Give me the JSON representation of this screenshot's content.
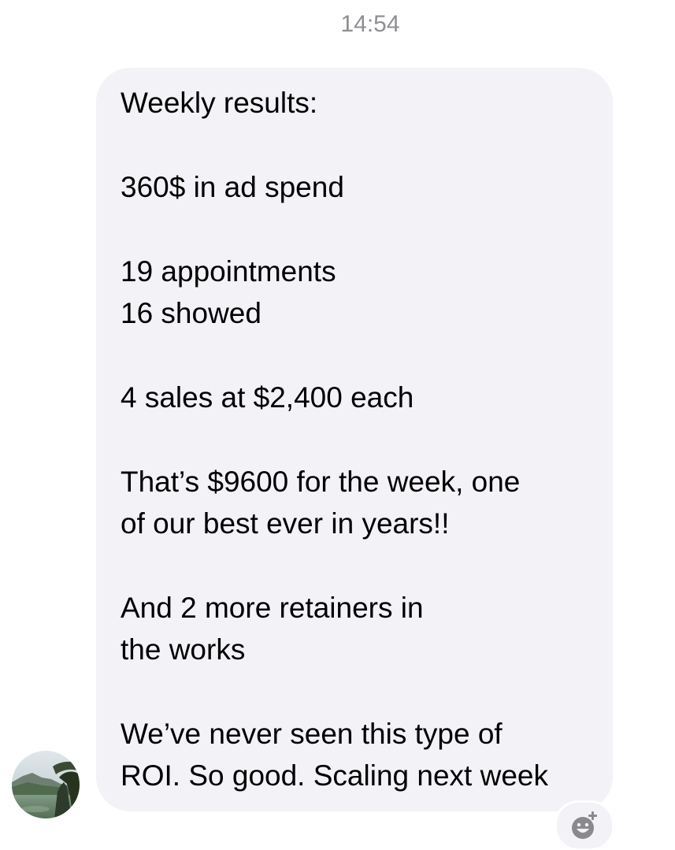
{
  "thread": {
    "timestamp": "14:54"
  },
  "message": {
    "paragraphs": [
      "Weekly results:",
      "360$ in ad spend",
      "19 appointments\n16 showed",
      "4 sales at $2,400 each",
      "That’s $9600 for the week, one\nof our best ever in years!!",
      "And 2 more retainers in\nthe works",
      "We’ve never seen this type of\nROI. So good. Scaling next week"
    ]
  },
  "icons": {
    "avatar": "sender-avatar",
    "reaction": "add-reaction-smiley-icon"
  },
  "colors": {
    "bubble": "#f2f2f7",
    "timestamp": "#8e8e93",
    "text": "#000000",
    "reaction_icon": "#8a8a8e"
  }
}
